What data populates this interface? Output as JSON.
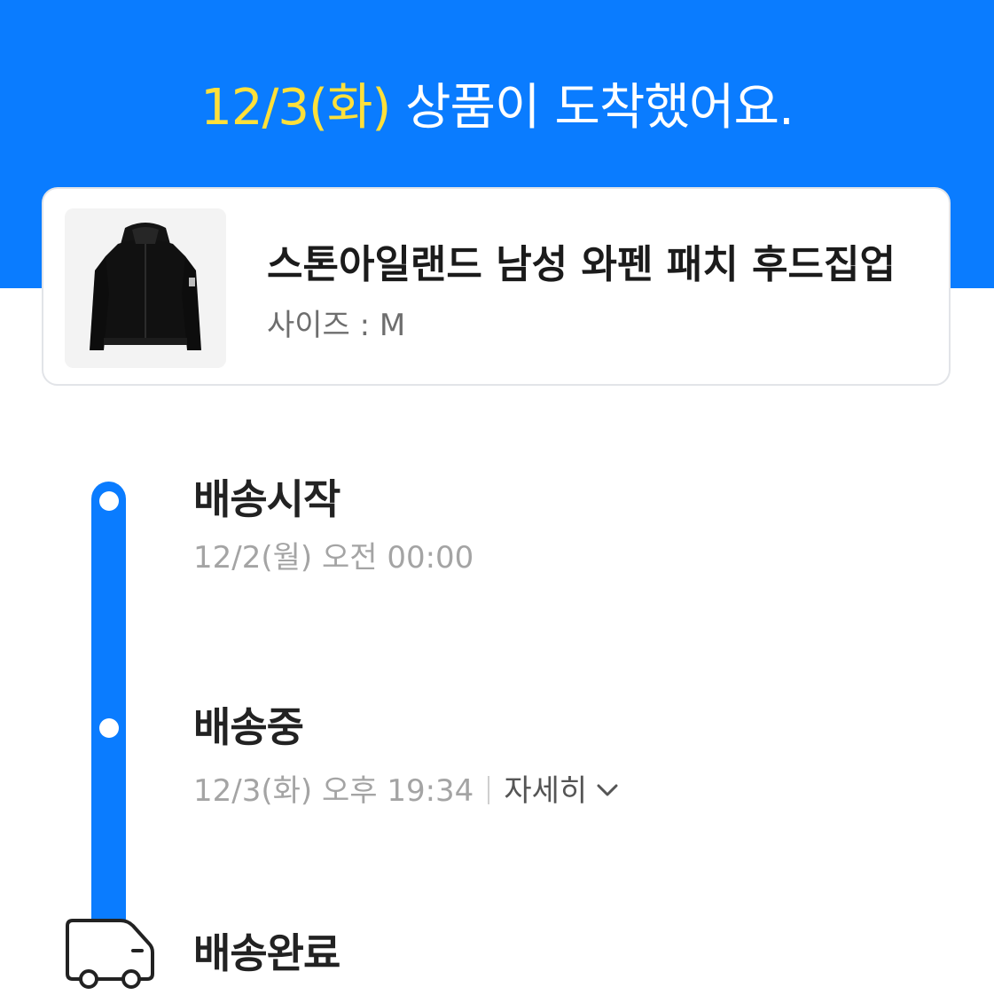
{
  "header": {
    "date": "12/3(화)",
    "message": "상품이 도착했어요."
  },
  "product": {
    "name": "스톤아일랜드 남성 와펜 패치 후드집업",
    "size_label": "사이즈 : M",
    "image_icon": "hoodie-jacket-image"
  },
  "timeline": {
    "steps": [
      {
        "title": "배송시작",
        "time": "12/2(월) 오전 00:00"
      },
      {
        "title": "배송중",
        "time": "12/3(화) 오후 19:34",
        "detail_label": "자세히"
      },
      {
        "title": "배송완료"
      }
    ],
    "current_icon": "delivery-truck-icon",
    "accent_color": "#0a7cff"
  }
}
